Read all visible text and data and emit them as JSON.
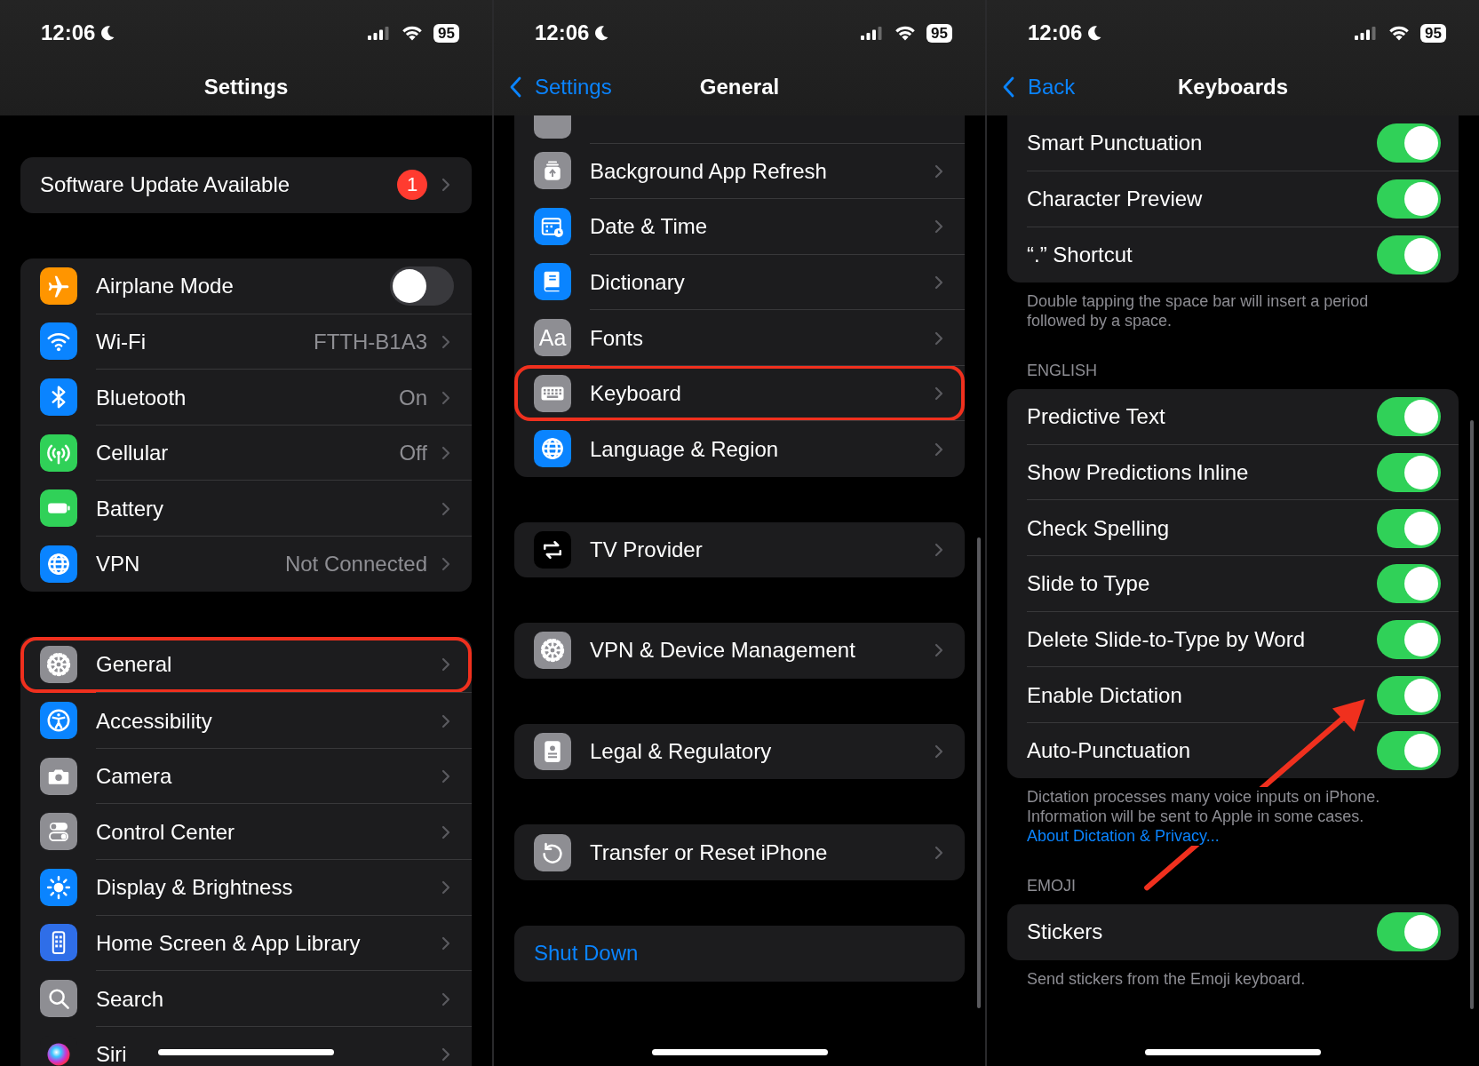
{
  "panels": [
    {
      "status": {
        "time": "12:06",
        "battery": "95"
      },
      "nav": {
        "title": "Settings"
      },
      "sections": [
        {
          "rows": [
            {
              "kind": "nav",
              "label": "Software Update Available",
              "badge": "1"
            }
          ]
        },
        {
          "rows": [
            {
              "kind": "toggle",
              "label": "Airplane Mode",
              "color": "#ff9500",
              "on": false
            },
            {
              "kind": "nav",
              "label": "Wi-Fi",
              "value": "FTTH-B1A3",
              "color": "#0a84ff"
            },
            {
              "kind": "nav",
              "label": "Bluetooth",
              "value": "On",
              "color": "#0a84ff"
            },
            {
              "kind": "nav",
              "label": "Cellular",
              "value": "Off",
              "color": "#30d158"
            },
            {
              "kind": "nav",
              "label": "Battery",
              "color": "#30d158"
            },
            {
              "kind": "nav",
              "label": "VPN",
              "value": "Not Connected",
              "color": "#0a84ff"
            }
          ]
        },
        {
          "rows": [
            {
              "kind": "nav",
              "label": "General",
              "color": "#8e8e93",
              "highlighted": true
            },
            {
              "kind": "nav",
              "label": "Accessibility",
              "color": "#0a84ff",
              "highlighted": false
            },
            {
              "kind": "nav",
              "label": "Camera",
              "color": "#8e8e93",
              "highlighted": false
            },
            {
              "kind": "nav",
              "label": "Control Center",
              "color": "#8e8e93",
              "highlighted": false
            },
            {
              "kind": "nav",
              "label": "Display & Brightness",
              "color": "#0a84ff",
              "highlighted": false
            },
            {
              "kind": "nav",
              "label": "Home Screen & App Library",
              "color": "#2f6ee8",
              "highlighted": false
            },
            {
              "kind": "nav",
              "label": "Search",
              "color": "#8e8e93",
              "highlighted": false
            },
            {
              "kind": "nav",
              "label": "Siri",
              "color": "#1c1c1e",
              "highlighted": false
            }
          ]
        }
      ]
    },
    {
      "status": {
        "time": "12:06",
        "battery": "95"
      },
      "nav": {
        "back": "Settings",
        "title": "General"
      },
      "sections": [
        {
          "rows": [
            {
              "kind": "nav",
              "color": "#8e8e93",
              "highlighted": false
            },
            {
              "kind": "nav",
              "label": "Background App Refresh",
              "color": "#8e8e93",
              "highlighted": false
            },
            {
              "kind": "nav",
              "label": "Date & Time",
              "color": "#0a84ff",
              "highlighted": false
            },
            {
              "kind": "nav",
              "label": "Dictionary",
              "color": "#0a84ff",
              "highlighted": false
            },
            {
              "kind": "nav",
              "label": "Fonts",
              "icon_text": "Aa",
              "color": "#8e8e93",
              "highlighted": false
            },
            {
              "kind": "nav",
              "label": "Keyboard",
              "color": "#8e8e93",
              "highlighted": true
            },
            {
              "kind": "nav",
              "label": "Language & Region",
              "color": "#0a84ff",
              "highlighted": false
            }
          ]
        },
        {
          "rows": [
            {
              "kind": "nav",
              "label": "TV Provider",
              "color": "#000000"
            }
          ]
        },
        {
          "rows": [
            {
              "kind": "nav",
              "label": "VPN & Device Management",
              "color": "#8e8e93"
            }
          ]
        },
        {
          "rows": [
            {
              "kind": "nav",
              "label": "Legal & Regulatory",
              "color": "#8e8e93"
            }
          ]
        },
        {
          "rows": [
            {
              "kind": "nav",
              "label": "Transfer or Reset iPhone",
              "color": "#8e8e93"
            }
          ]
        },
        {
          "rows": [
            {
              "kind": "link",
              "label": "Shut Down"
            }
          ]
        }
      ]
    },
    {
      "status": {
        "time": "12:06",
        "battery": "95"
      },
      "nav": {
        "back": "Back",
        "title": "Keyboards"
      },
      "sections": [
        {
          "rows": [
            {
              "kind": "toggle",
              "label": "Smart Punctuation",
              "on": true
            },
            {
              "kind": "toggle",
              "label": "Character Preview",
              "on": true
            },
            {
              "kind": "toggle",
              "label": "“.” Shortcut",
              "on": true
            }
          ],
          "footer": "Double tapping the space bar will insert a period followed by a space."
        },
        {
          "header": "ENGLISH",
          "rows": [
            {
              "kind": "toggle",
              "label": "Predictive Text",
              "on": true
            },
            {
              "kind": "toggle",
              "label": "Show Predictions Inline",
              "on": true
            },
            {
              "kind": "toggle",
              "label": "Check Spelling",
              "on": true
            },
            {
              "kind": "toggle",
              "label": "Slide to Type",
              "on": true
            },
            {
              "kind": "toggle",
              "label": "Delete Slide-to-Type by Word",
              "on": true
            },
            {
              "kind": "toggle",
              "label": "Enable Dictation",
              "on": true
            },
            {
              "kind": "toggle",
              "label": "Auto-Punctuation",
              "on": true
            }
          ],
          "footer": "Dictation processes many voice inputs on iPhone. Information will be sent to Apple in some cases.",
          "footer_link": "About Dictation & Privacy..."
        },
        {
          "header": "EMOJI",
          "rows": [
            {
              "kind": "toggle",
              "label": "Stickers",
              "on": true
            }
          ],
          "footer": "Send stickers from the Emoji keyboard."
        }
      ]
    }
  ]
}
